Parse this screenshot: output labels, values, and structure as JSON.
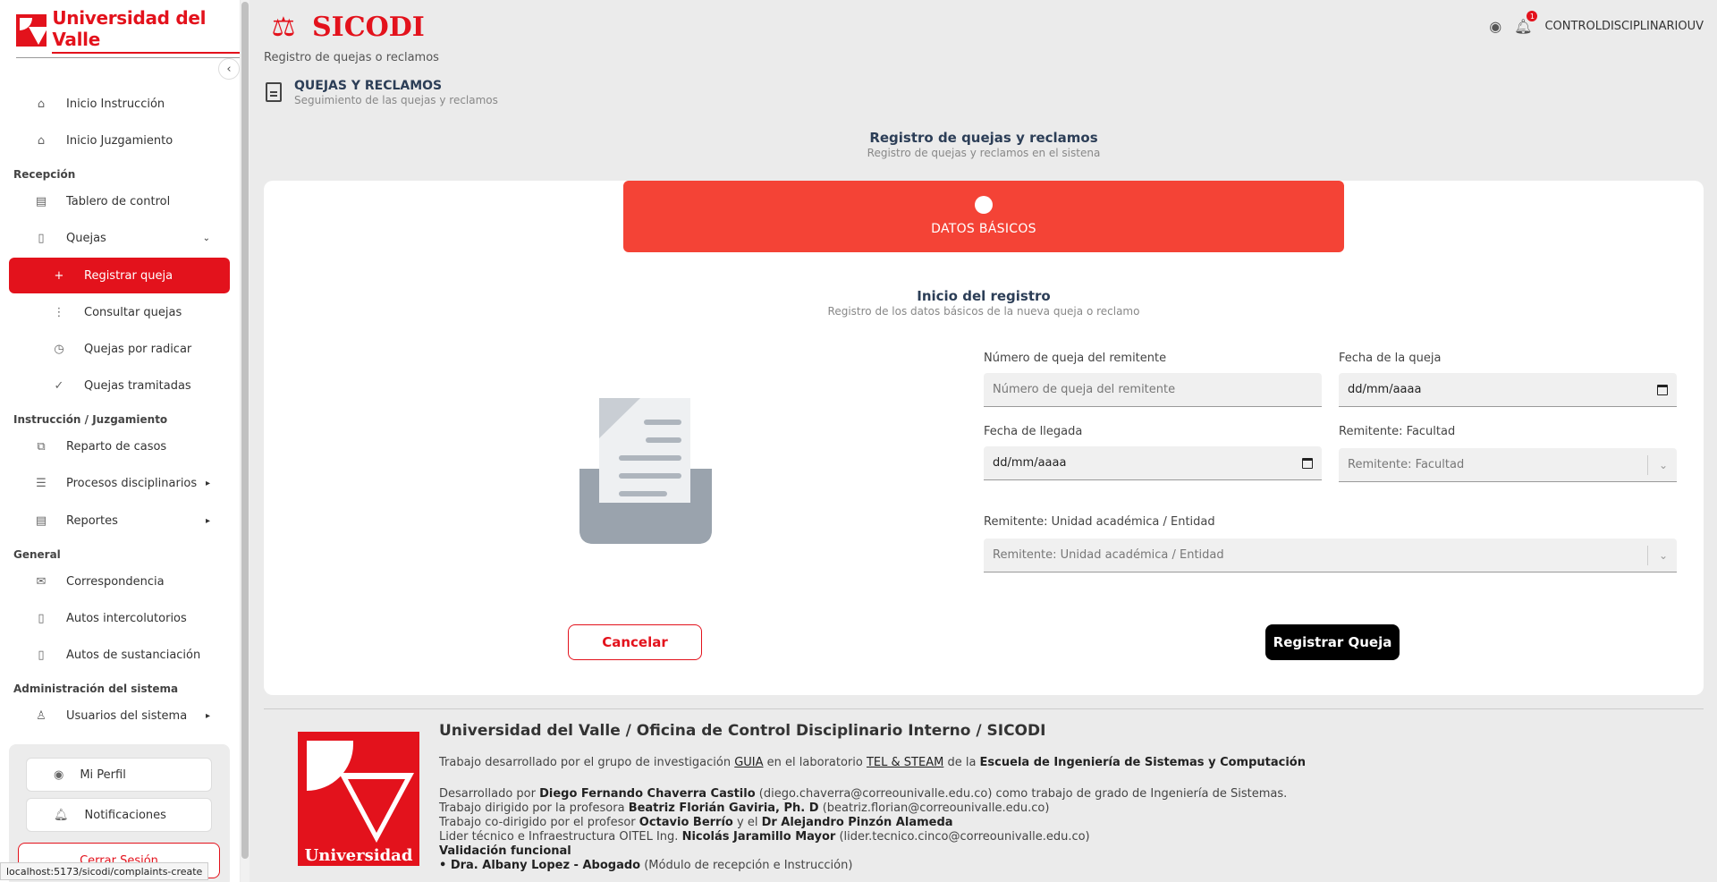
{
  "sidebar": {
    "logo_text": "Universidad del Valle",
    "items": {
      "inicio_instruccion": "Inicio Instrucción",
      "inicio_juzgamiento": "Inicio Juzgamiento",
      "tablero": "Tablero de control",
      "quejas": "Quejas",
      "registrar": "Registrar queja",
      "consultar": "Consultar quejas",
      "por_radicar": "Quejas por radicar",
      "tramitadas": "Quejas tramitadas",
      "reparto": "Reparto de casos",
      "procesos": "Procesos disciplinarios",
      "reportes": "Reportes",
      "correspondencia": "Correspondencia",
      "autos_inter": "Autos intercolutorios",
      "autos_sust": "Autos de sustanciación",
      "usuarios": "Usuarios del sistema"
    },
    "sections": {
      "recepcion": "Recepción",
      "instruccion": "Instrucción / Juzgamiento",
      "general": "General",
      "admin": "Administración del sistema"
    },
    "bottom": {
      "perfil": "Mi Perfil",
      "notificaciones": "Notificaciones",
      "cerrar": "Cerrar Sesión"
    }
  },
  "status_url": "localhost:5173/sicodi/complaints-create",
  "header": {
    "brand": "SICODI",
    "brand_sub": "Registro de quejas o reclamos",
    "user": "CONTROLDISCIPLINARIOUV",
    "notif_count": "1"
  },
  "page": {
    "title": "QUEJAS Y RECLAMOS",
    "subtitle": "Seguimiento de las quejas y reclamos"
  },
  "main": {
    "title": "Registro de quejas y reclamos",
    "subtitle": "Registro de quejas y reclamos en el sistena"
  },
  "step": {
    "label": "DATOS BÁSICOS"
  },
  "form": {
    "title": "Inicio del registro",
    "subtitle": "Registro de los datos básicos de la nueva queja o reclamo",
    "numero_label": "Número de queja del remitente",
    "numero_placeholder": "Número de queja del remitente",
    "fecha_queja_label": "Fecha de la queja",
    "fecha_queja_value": "dd/mm/aaaa",
    "fecha_llegada_label": "Fecha de llegada",
    "fecha_llegada_value": "dd/mm/aaaa",
    "facultad_label": "Remitente: Facultad",
    "facultad_placeholder": "Remitente: Facultad",
    "unidad_label": "Remitente: Unidad académica / Entidad",
    "unidad_placeholder": "Remitente: Unidad académica / Entidad",
    "cancel": "Cancelar",
    "submit": "Registrar Queja"
  },
  "footer": {
    "logo_text": "Universidad",
    "title": "Universidad del Valle / Oficina de Control Disciplinario Interno / SICODI",
    "l1_a": "Trabajo desarrollado por el grupo de investigación ",
    "l1_b": "GUIA",
    "l1_c": " en el laboratorio ",
    "l1_d": "TEL & STEAM",
    "l1_e": " de la ",
    "l1_f": "Escuela de Ingeniería de Sistemas y Computación",
    "l2_a": "Desarrollado por ",
    "l2_b": "Diego Fernando Chaverra Castilo",
    "l2_c": " (diego.chaverra@correounivalle.edu.co) como trabajo de grado de Ingeniería de Sistemas.",
    "l3_a": "Trabajo dirigido por la profesora ",
    "l3_b": "Beatriz Florián Gaviria, Ph. D",
    "l3_c": " (beatriz.florian@correounivalle.edu.co)",
    "l4_a": "Trabajo co-dirigido por el profesor ",
    "l4_b": "Octavio Berrío",
    "l4_c": " y el ",
    "l4_d": "Dr Alejandro Pinzón Alameda",
    "l5_a": "Lider técnico e Infraestructura OITEL Ing. ",
    "l5_b": "Nicolás Jaramillo Mayor",
    "l5_c": " (lider.tecnico.cinco@correounivalle.edu.co)",
    "l6": "Validación funcional",
    "l7_a": "• Dra. Albany Lopez - Abogado",
    "l7_b": " (Módulo de recepción e Instrucción)"
  },
  "colors": {
    "brand": "#e3121c",
    "step": "#f44336",
    "primary_button": "#000000"
  }
}
